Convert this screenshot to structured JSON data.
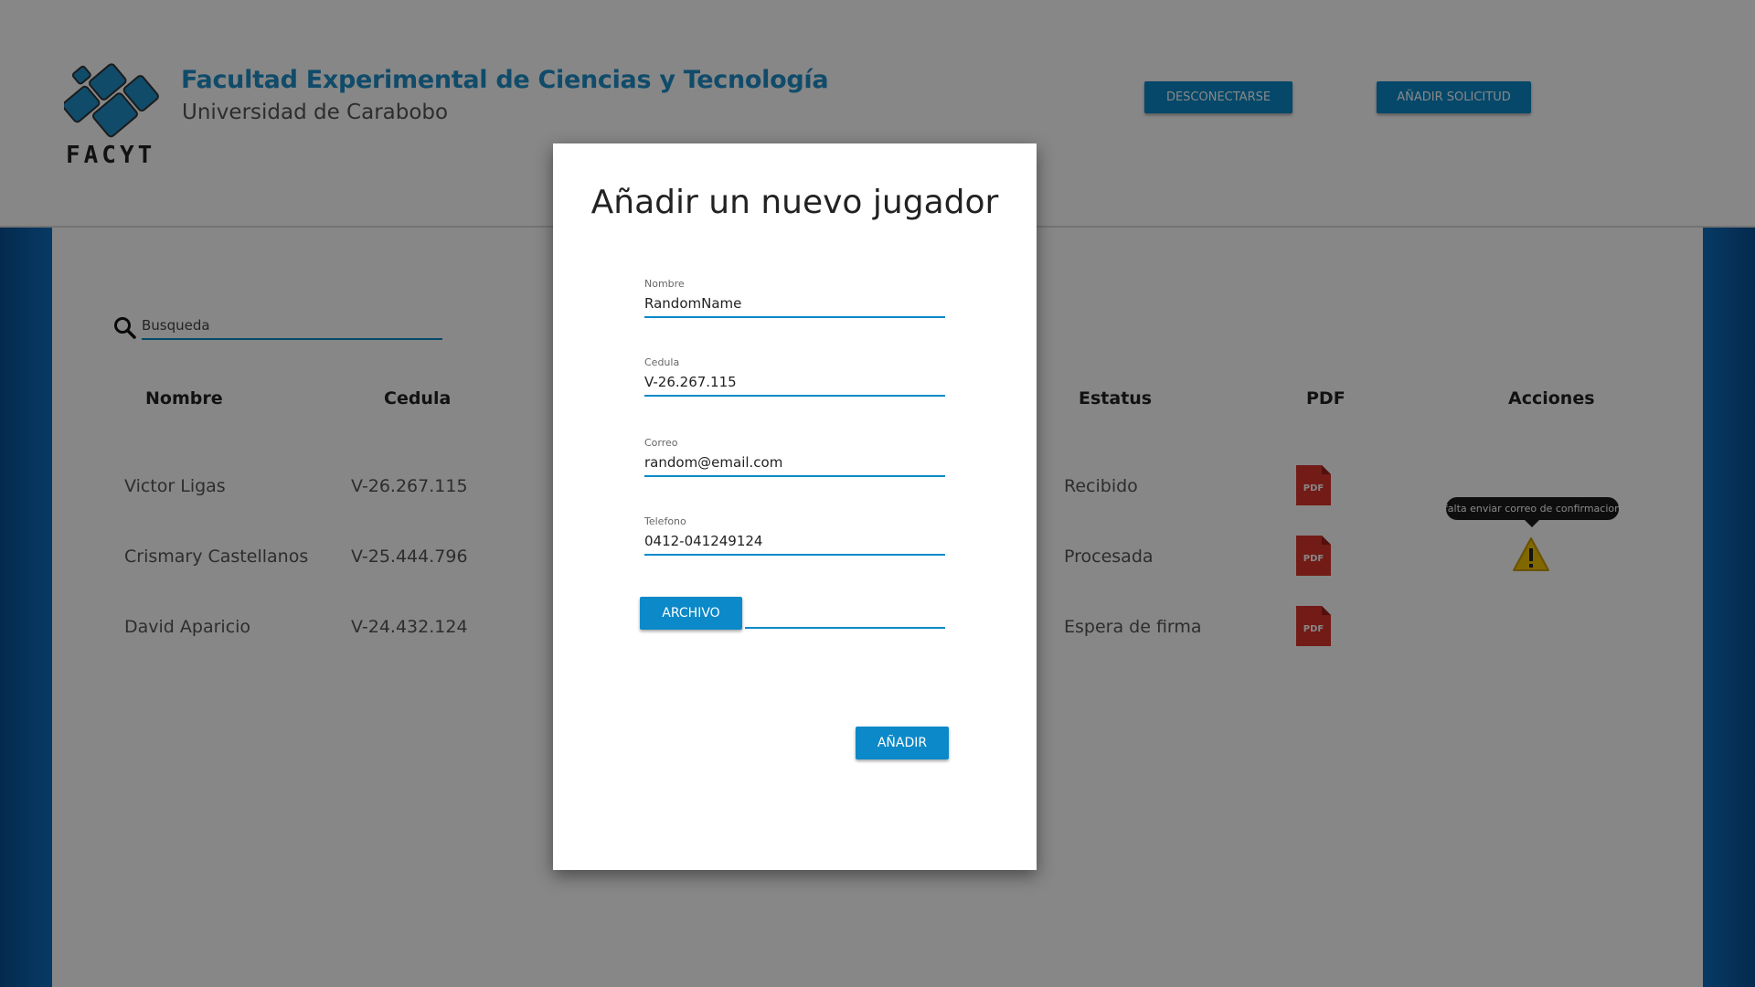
{
  "header": {
    "faculty_name": "Facultad Experimental de Ciencias y Tecnología",
    "university_name": "Universidad de Carabobo",
    "brand": "FACYT",
    "logout_label": "DESCONECTARSE",
    "add_request_label": "AÑADIR SOLICITUD"
  },
  "search": {
    "placeholder": "Busqueda"
  },
  "table": {
    "headers": {
      "nombre": "Nombre",
      "cedula": "Cedula",
      "estatus": "Estatus",
      "pdf": "PDF",
      "acciones": "Acciones"
    },
    "rows": [
      {
        "nombre": "Victor Ligas",
        "cedula": "V-26.267.115",
        "estatus": "Recibido",
        "pdf_label": "PDF"
      },
      {
        "nombre": "Crismary Castellanos",
        "cedula": "V-25.444.796",
        "estatus": "Procesada",
        "pdf_label": "PDF"
      },
      {
        "nombre": "David Aparicio",
        "cedula": "V-24.432.124",
        "estatus": "Espera de firma",
        "pdf_label": "PDF"
      }
    ],
    "warning_tooltip": "falta enviar correo de confirmacion"
  },
  "modal": {
    "title": "Añadir un nuevo jugador",
    "fields": {
      "nombre": {
        "label": "Nombre",
        "value": "RandomName"
      },
      "cedula": {
        "label": "Cedula",
        "value": "V-26.267.115"
      },
      "correo": {
        "label": "Correo",
        "value": "random@email.com"
      },
      "telefono": {
        "label": "Telefono",
        "value": "0412-041249124"
      }
    },
    "file_button_label": "ARCHIVO",
    "submit_label": "AÑADIR"
  },
  "colors": {
    "accent": "#0b89c8",
    "sidebar": "#0d5fa8",
    "pdf_red": "#d9342b",
    "warning_yellow": "#f2c200"
  },
  "icons": {
    "search": "search-icon",
    "pdf": "pdf-file-icon",
    "warning": "warning-icon",
    "logo": "facyt-logo"
  }
}
